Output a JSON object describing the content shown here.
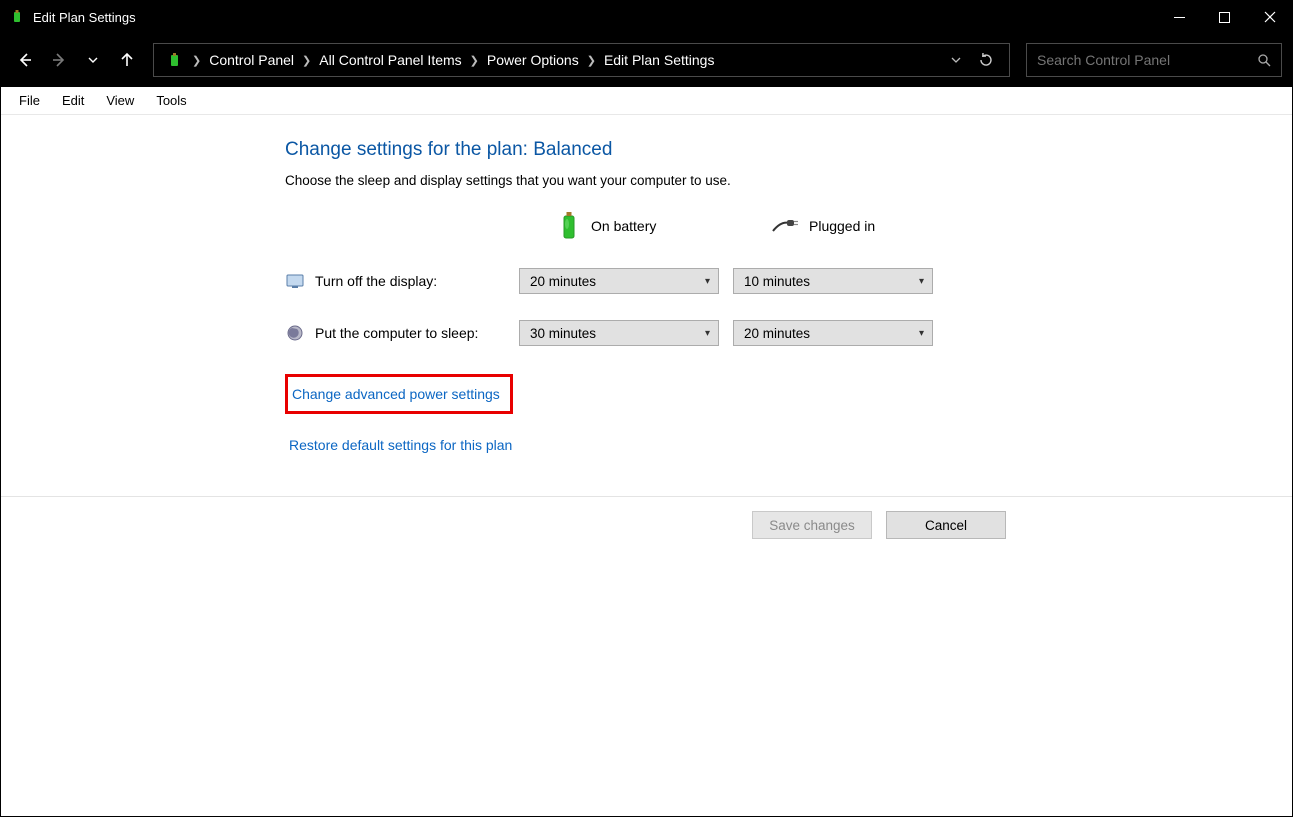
{
  "window": {
    "title": "Edit Plan Settings"
  },
  "breadcrumb": {
    "items": [
      "Control Panel",
      "All Control Panel Items",
      "Power Options",
      "Edit Plan Settings"
    ]
  },
  "search": {
    "placeholder": "Search Control Panel"
  },
  "menu": {
    "items": [
      "File",
      "Edit",
      "View",
      "Tools"
    ]
  },
  "page": {
    "title": "Change settings for the plan: Balanced",
    "description": "Choose the sleep and display settings that you want your computer to use.",
    "columns": {
      "battery": "On battery",
      "plugged": "Plugged in"
    },
    "rows": {
      "display": {
        "label": "Turn off the display:",
        "battery": "20 minutes",
        "plugged": "10 minutes"
      },
      "sleep": {
        "label": "Put the computer to sleep:",
        "battery": "30 minutes",
        "plugged": "20 minutes"
      }
    },
    "links": {
      "advanced": "Change advanced power settings",
      "restore": "Restore default settings for this plan"
    },
    "buttons": {
      "save": "Save changes",
      "cancel": "Cancel"
    }
  }
}
